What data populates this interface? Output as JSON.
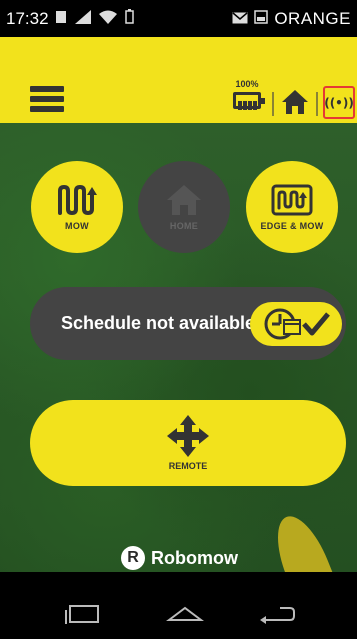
{
  "status_bar": {
    "time": "17:32",
    "carrier": "ORANGE"
  },
  "header": {
    "battery_percent": "100%",
    "signal_glyph": "((•))"
  },
  "actions": {
    "mow_label": "MOW",
    "home_label": "HOME",
    "edge_mow_label": "EDGE & MOW"
  },
  "schedule": {
    "text": "Schedule not available"
  },
  "remote": {
    "label": "REMOTE"
  },
  "brand": {
    "badge": "R",
    "name": "Robomow"
  },
  "colors": {
    "accent": "#f2e21c",
    "disabled": "#444444",
    "highlight": "#e53935"
  }
}
